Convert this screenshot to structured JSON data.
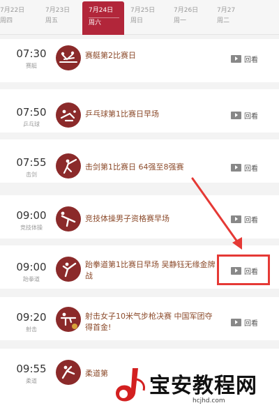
{
  "dates": [
    {
      "date": "7月22日",
      "weekday": "周四",
      "active": false
    },
    {
      "date": "7月23日",
      "weekday": "周五",
      "active": false
    },
    {
      "date": "7月24日",
      "weekday": "周六",
      "active": true
    },
    {
      "date": "7月25日",
      "weekday": "周日",
      "active": false
    },
    {
      "date": "7月26日",
      "weekday": "周一",
      "active": false
    },
    {
      "date": "7月27",
      "weekday": "周二",
      "active": false
    }
  ],
  "schedule": [
    {
      "time": "07:30",
      "sport": "赛艇",
      "title": "赛艇第2比赛日",
      "replay": "回看",
      "icon": "rowing-icon"
    },
    {
      "time": "07:50",
      "sport": "乒乓球",
      "title": "乒乓球第1比赛日早场",
      "replay": "回看",
      "icon": "table-tennis-icon"
    },
    {
      "time": "07:55",
      "sport": "击剑",
      "title": "击剑第1比赛日 64强至8强赛",
      "replay": "回看",
      "icon": "fencing-icon"
    },
    {
      "time": "09:00",
      "sport": "竞技体操",
      "title": "竞技体操男子资格赛早场",
      "replay": "回看",
      "icon": "gymnastics-icon"
    },
    {
      "time": "09:00",
      "sport": "跆拳道",
      "title": "跆拳道第1比赛日早场 吴静钰无缘金牌战",
      "replay": "回看",
      "icon": "taekwondo-icon"
    },
    {
      "time": "09:20",
      "sport": "射击",
      "title": "射击女子10米气步枪决赛 中国军团夺得首金!",
      "replay": "回看",
      "icon": "shooting-icon"
    },
    {
      "time": "09:55",
      "sport": "柔道",
      "title": "柔道第",
      "replay": "",
      "icon": "judo-icon"
    }
  ],
  "watermark": {
    "name": "宝安教程网",
    "url": "hcjhd.com"
  },
  "colors": {
    "accent": "#b2263a",
    "pictogram": "#8b2a2a",
    "highlight": "#e53935",
    "title_text": "#8b4a2a"
  }
}
